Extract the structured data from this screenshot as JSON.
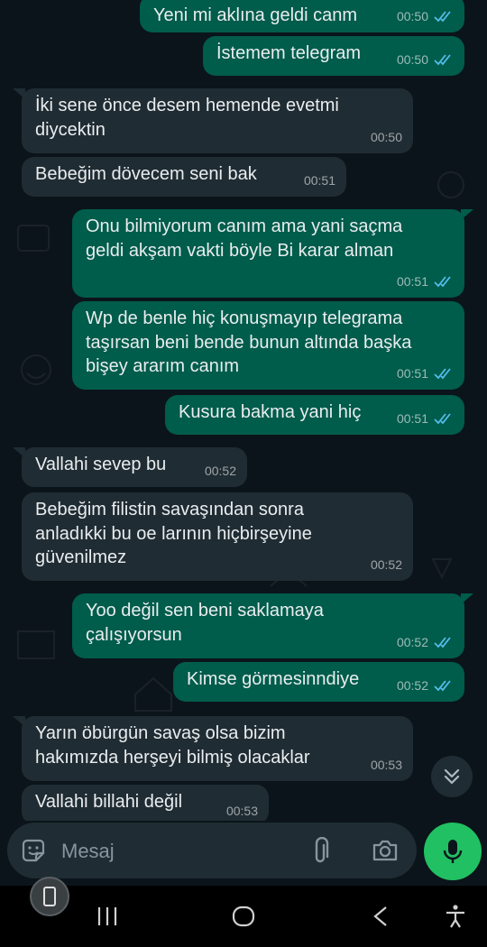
{
  "messages": [
    {
      "dir": "out",
      "text": "Yeni mi aklına geldi canm",
      "time": "00:50",
      "read": true
    },
    {
      "dir": "out",
      "text": "İstemem telegram",
      "time": "00:50",
      "read": true
    },
    {
      "dir": "in",
      "text": "İki sene önce desem hemende evetmi\ndiycektin",
      "time": "00:50"
    },
    {
      "dir": "in",
      "text": "Bebeğim dövecem seni bak",
      "time": "00:51"
    },
    {
      "dir": "out",
      "text": "Onu bilmiyorum canım ama yani saçma\ngeldi akşam vakti böyle Bi karar alman",
      "time": "00:51",
      "read": true
    },
    {
      "dir": "out",
      "text": "Wp de benle hiç konuşmayıp telegrama\ntaşırsan beni bende bunun altında başka\nbişey ararım canım",
      "time": "00:51",
      "read": true
    },
    {
      "dir": "out",
      "text": "Kusura bakma yani hiç",
      "time": "00:51",
      "read": true
    },
    {
      "dir": "in",
      "text": "Vallahi sevep bu",
      "time": "00:52"
    },
    {
      "dir": "in",
      "text": "Bebeğim filistin savaşından sonra\nanladıkki bu oe larının hiçbirşeyine\ngüvenilmez",
      "time": "00:52"
    },
    {
      "dir": "out",
      "text": "Yoo değil sen beni saklamaya\nçalışıyorsun",
      "time": "00:52",
      "read": true
    },
    {
      "dir": "out",
      "text": "Kimse görmesinndiye",
      "time": "00:52",
      "read": true
    },
    {
      "dir": "in",
      "text": "Yarın öbürgün savaş olsa bizim\nhakımızda herşeyi bilmiş olacaklar",
      "time": "00:53"
    },
    {
      "dir": "in",
      "text": "Vallahi billahi değil",
      "time": "00:53"
    }
  ],
  "composer": {
    "placeholder": "Mesaj"
  },
  "icons": {
    "read_tick": "double-check-icon",
    "emoji": "sticker-smiley-icon",
    "attach": "paperclip-icon",
    "camera": "camera-icon",
    "mic": "microphone-icon",
    "scroll": "double-chevron-down-icon"
  },
  "colors": {
    "outgoing": "#005c4b",
    "incoming": "#202c33",
    "read_tick": "#53bdeb",
    "mic_button": "#21c063"
  }
}
